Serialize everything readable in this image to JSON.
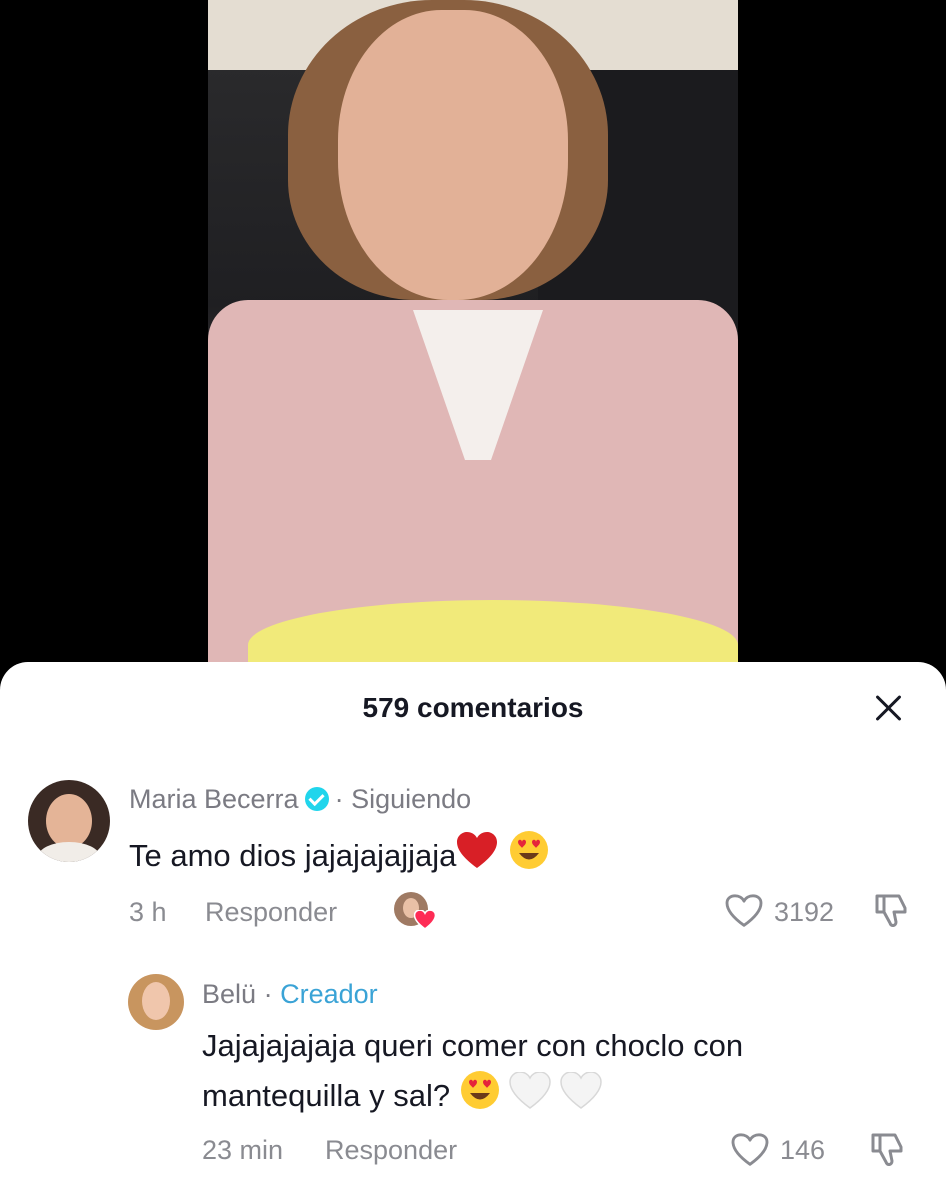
{
  "comments_sheet": {
    "title": "579 comentarios"
  },
  "comments": [
    {
      "author": "Maria Becerra",
      "separator": "·",
      "relation": "Siguiendo",
      "text": "Te amo dios jajajajajjaja",
      "emojis": [
        "red-heart-emoji",
        "heart-eyes-emoji"
      ],
      "time": "3 h",
      "reply_label": "Responder",
      "likes": "3192",
      "creator_liked": true
    },
    {
      "author": "Belü",
      "separator": "·",
      "role": "Creador",
      "text_line1": "Jajajajajaja queri comer con choclo con",
      "text_line2": "mantequilla y sal?",
      "emojis": [
        "heart-eyes-emoji",
        "white-heart-emoji",
        "white-heart-emoji"
      ],
      "time": "23 min",
      "reply_label": "Responder",
      "likes": "146"
    }
  ],
  "colors": {
    "verified": "#20d5ec",
    "creator": "#3aa3d6",
    "meta": "#8a8b91",
    "text": "#161823"
  }
}
